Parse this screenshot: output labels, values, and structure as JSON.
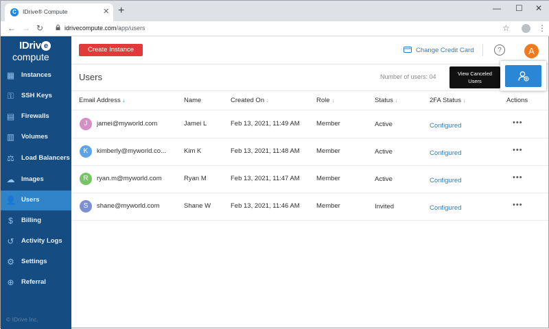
{
  "browser": {
    "tab_title": "IDrive® Compute",
    "tab_favicon_letter": "C",
    "url_host": "idrivecompute.com",
    "url_path": "/app/users"
  },
  "brand": {
    "line1": "IDriv",
    "e": "e",
    "line2": "compute",
    "copyright": "© IDrive Inc."
  },
  "sidebar": {
    "items": [
      {
        "label": "Instances",
        "icon": "instances-icon",
        "glyph": "▦"
      },
      {
        "label": "SSH Keys",
        "icon": "key-icon",
        "glyph": "⚿"
      },
      {
        "label": "Firewalls",
        "icon": "firewall-icon",
        "glyph": "▤"
      },
      {
        "label": "Volumes",
        "icon": "volumes-icon",
        "glyph": "▥"
      },
      {
        "label": "Load Balancers",
        "icon": "load-balancer-icon",
        "glyph": "⚖"
      },
      {
        "label": "Images",
        "icon": "images-icon",
        "glyph": "☁"
      },
      {
        "label": "Users",
        "icon": "user-icon",
        "glyph": "👤"
      },
      {
        "label": "Billing",
        "icon": "billing-icon",
        "glyph": "$"
      },
      {
        "label": "Activity Logs",
        "icon": "activity-logs-icon",
        "glyph": "↺"
      },
      {
        "label": "Settings",
        "icon": "gear-icon",
        "glyph": "⚙"
      },
      {
        "label": "Referral",
        "icon": "referral-icon",
        "glyph": "⊕"
      }
    ],
    "active_index": 6
  },
  "header": {
    "create_label": "Create Instance",
    "credit_label": "Change Credit Card",
    "help_glyph": "?",
    "avatar_letter": "A"
  },
  "page": {
    "title": "Users",
    "count_text": "Number of users: 04",
    "view_canceled_line1": "View Canceled",
    "view_canceled_line2": "Users"
  },
  "table": {
    "headers": {
      "email": "Email Address",
      "name": "Name",
      "created": "Created On",
      "role": "Role",
      "status": "Status",
      "twofa": "2FA Status",
      "actions": "Actions"
    },
    "rows": [
      {
        "initial": "J",
        "color": "#d68fc4",
        "email": "jamei@myworld.com",
        "name": "Jamei L",
        "created": "Feb 13, 2021, 11:49 AM",
        "role": "Member",
        "status": "Active",
        "twofa": "Configured"
      },
      {
        "initial": "K",
        "color": "#5ea3e6",
        "email": "kimberly@myworld.co...",
        "name": "Kim K",
        "created": "Feb 13, 2021, 11:48 AM",
        "role": "Member",
        "status": "Active",
        "twofa": "Configured"
      },
      {
        "initial": "R",
        "color": "#76c467",
        "email": "ryan.m@myworld.com",
        "name": "Ryan M",
        "created": "Feb 13, 2021, 11:47 AM",
        "role": "Member",
        "status": "Active",
        "twofa": "Configured"
      },
      {
        "initial": "S",
        "color": "#7b8fd1",
        "email": "shane@myworld.com",
        "name": "Shane W",
        "created": "Feb 13, 2021, 11:46 AM",
        "role": "Member",
        "status": "Invited",
        "twofa": "Configured"
      }
    ],
    "actions_glyph": "•••"
  },
  "colors": {
    "sidebar_bg": "#154c82",
    "sidebar_active": "#2f83c8",
    "create_button": "#e23a3a",
    "primary_blue": "#2a87d6",
    "avatar_orange": "#f07a1e"
  }
}
